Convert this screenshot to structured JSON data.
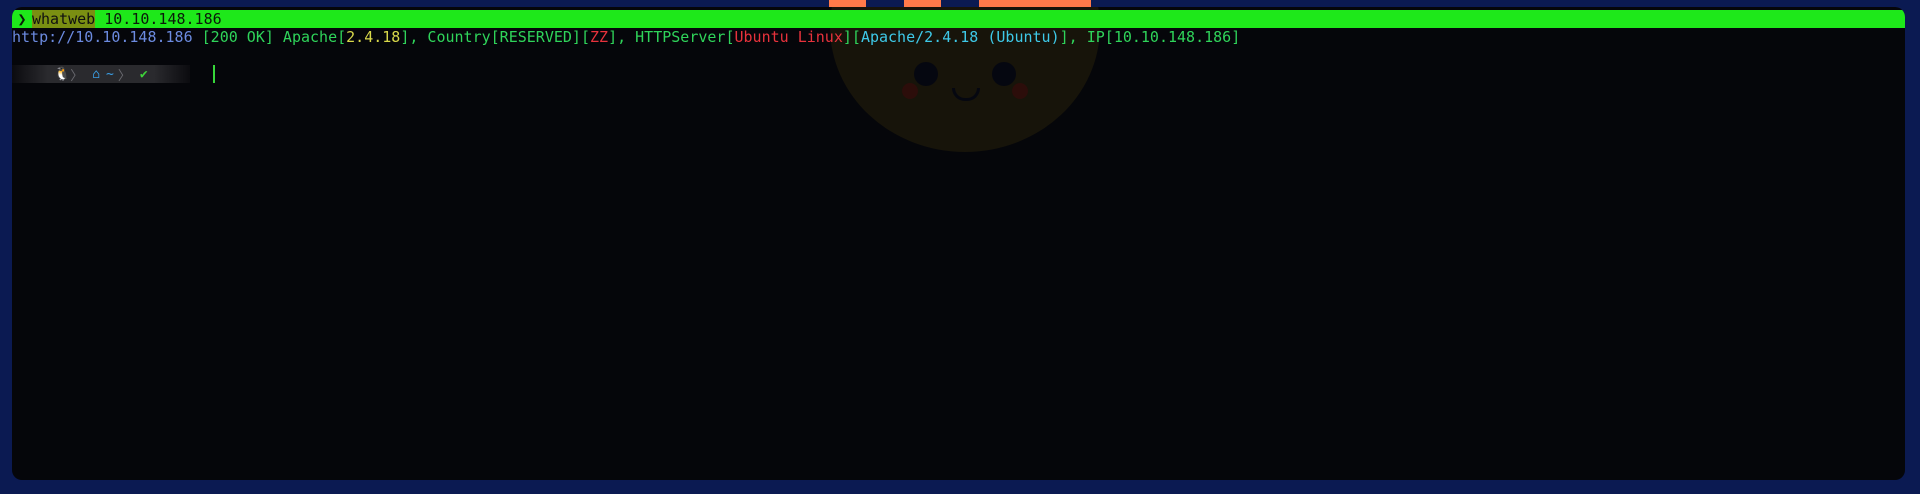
{
  "window": {
    "top_strip": [
      {
        "color": "#ff7a4a",
        "left": 0
      },
      {
        "color": "#ff7a4a",
        "left": 0
      },
      {
        "color": "#ff7a4a",
        "left": 0
      }
    ]
  },
  "terminal": {
    "command": {
      "prompt_symbol": "❯",
      "program": "whatweb",
      "argument": " 10.10.148.186"
    },
    "output": {
      "url": "http://10.10.148.186",
      "p1": " [200 OK] Apache[",
      "apache_ver": "2.4.18",
      "p2": "], Country[RESERVED][",
      "zz": "ZZ",
      "p3": "], HTTPServer[",
      "os": "Ubuntu Linux",
      "p4": "][",
      "apache_full": "Apache/2.4.18 (Ubuntu)",
      "p5": "], IP[",
      "ip": "10.10.148.186",
      "p6": "]"
    },
    "prompt": {
      "os_icon": "linux-icon",
      "os_glyph": "🐧",
      "separator": "〉",
      "home_icon": "home-icon",
      "home_glyph": "⌂",
      "dir": "~",
      "status_icon": "check-icon",
      "status_glyph": "✔"
    }
  },
  "colors": {
    "highlight": "#1ee81a",
    "output_green": "#2fd45a",
    "url_blue": "#6c8be0",
    "version_yellow": "#d8d84a",
    "error_red": "#e8323c",
    "cyan": "#3ec9e8"
  }
}
